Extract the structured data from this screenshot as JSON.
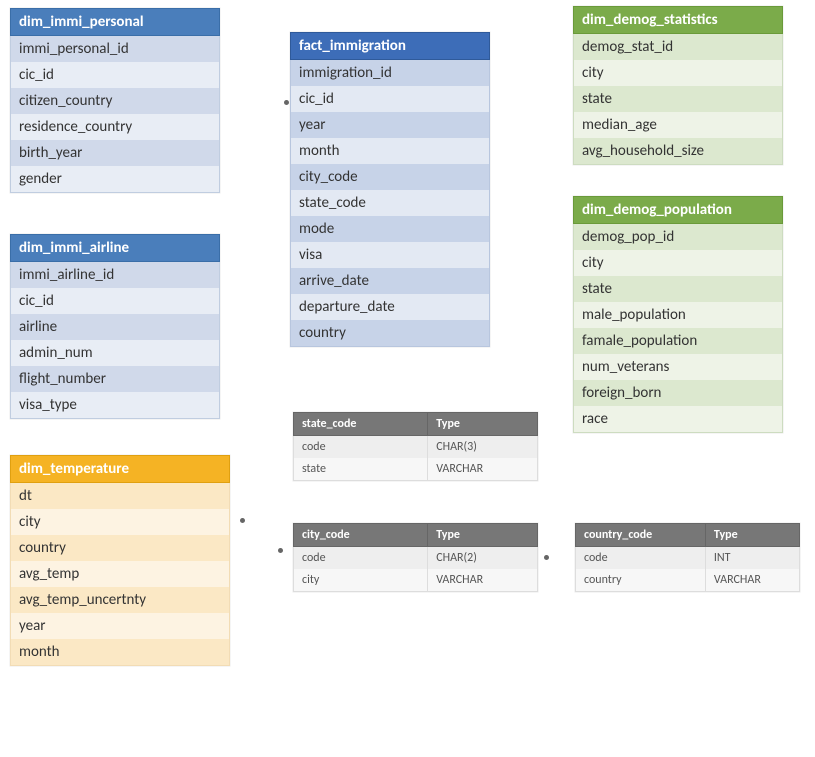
{
  "tables": {
    "dim_immi_personal": {
      "title": "dim_immi_personal",
      "cols": [
        "immi_personal_id",
        "cic_id",
        "citizen_country",
        "residence_country",
        "birth_year",
        "gender"
      ]
    },
    "dim_immi_airline": {
      "title": "dim_immi_airline",
      "cols": [
        "immi_airline_id",
        "cic_id",
        "airline",
        "admin_num",
        "flight_number",
        "visa_type"
      ]
    },
    "dim_temperature": {
      "title": "dim_temperature",
      "cols": [
        "dt",
        "city",
        "country",
        "avg_temp",
        "avg_temp_uncertnty",
        "year",
        "month"
      ]
    },
    "fact_immigration": {
      "title": "fact_immigration",
      "cols": [
        "immigration_id",
        "cic_id",
        "year",
        "month",
        "city_code",
        "state_code",
        "mode",
        "visa",
        "arrive_date",
        "departure_date",
        "country"
      ]
    },
    "dim_demog_statistics": {
      "title": "dim_demog_statistics",
      "cols": [
        "demog_stat_id",
        "city",
        "state",
        "median_age",
        "avg_household_size"
      ]
    },
    "dim_demog_population": {
      "title": "dim_demog_population",
      "cols": [
        "demog_pop_id",
        "city",
        "state",
        "male_population",
        "famale_population",
        "num_veterans",
        "foreign_born",
        "race"
      ]
    }
  },
  "lookup": {
    "state_code": {
      "hdr1": "state_code",
      "hdr2": "Type",
      "rows": [
        [
          "code",
          "CHAR(3)"
        ],
        [
          "state",
          "VARCHAR"
        ]
      ]
    },
    "city_code": {
      "hdr1": "city_code",
      "hdr2": "Type",
      "rows": [
        [
          "code",
          "CHAR(2)"
        ],
        [
          "city",
          "VARCHAR"
        ]
      ]
    },
    "country_code": {
      "hdr1": "country_code",
      "hdr2": "Type",
      "rows": [
        [
          "code",
          "INT"
        ],
        [
          "country",
          "VARCHAR"
        ]
      ]
    }
  }
}
